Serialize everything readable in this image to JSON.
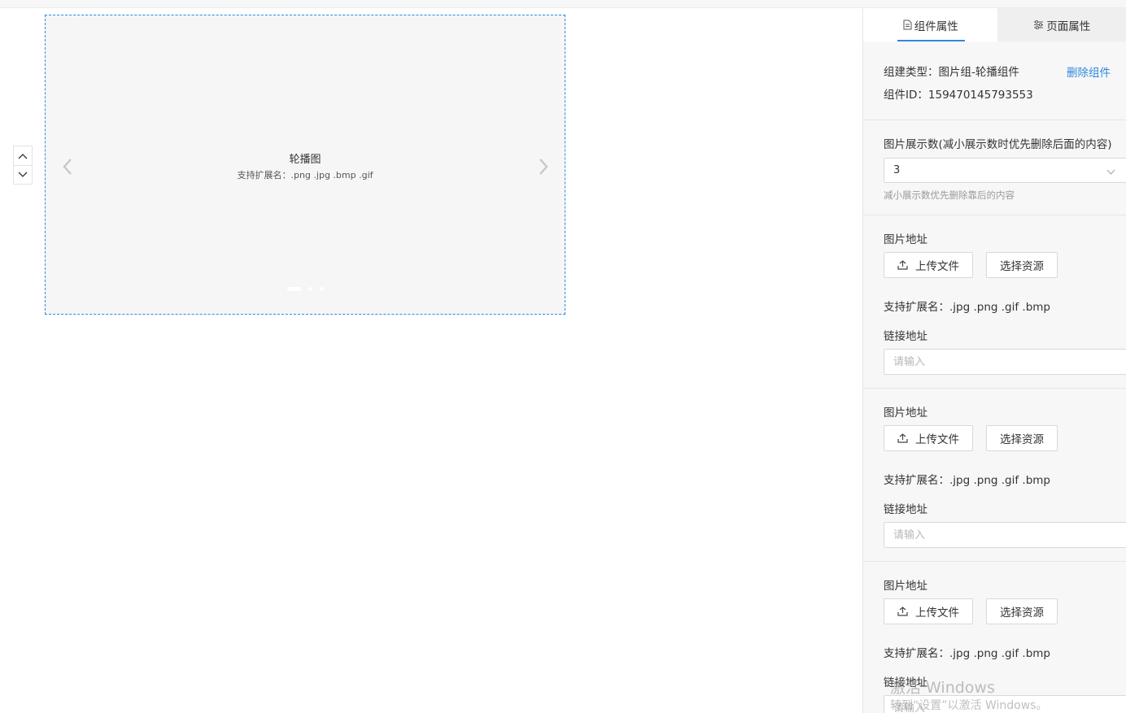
{
  "canvas": {
    "carousel": {
      "title": "轮播图",
      "subtitle": "支持扩展名：.png .jpg .bmp .gif",
      "dot_count": 3,
      "active_dot": 1
    }
  },
  "panel": {
    "tabs": [
      {
        "label": "组件属性",
        "icon": "document-icon",
        "active": true
      },
      {
        "label": "页面属性",
        "icon": "sliders-icon",
        "active": false
      }
    ],
    "component": {
      "type_label": "组建类型：",
      "type_value": "图片组-轮播组件",
      "delete_label": "删除组件",
      "id_label": "组件ID：",
      "id_value": "159470145793553"
    },
    "display_count": {
      "label": "图片展示数(减小展示数时优先删除后面的内容)",
      "value": "3",
      "hint": "减小展示数优先删除靠后的内容"
    },
    "images": [
      {
        "address_label": "图片地址",
        "upload_label": "上传文件",
        "resource_label": "选择资源",
        "ext_label": "支持扩展名：.jpg .png .gif .bmp",
        "link_label": "链接地址",
        "link_placeholder": "请输入",
        "link_value": ""
      },
      {
        "address_label": "图片地址",
        "upload_label": "上传文件",
        "resource_label": "选择资源",
        "ext_label": "支持扩展名：.jpg .png .gif .bmp",
        "link_label": "链接地址",
        "link_placeholder": "请输入",
        "link_value": ""
      },
      {
        "address_label": "图片地址",
        "upload_label": "上传文件",
        "resource_label": "选择资源",
        "ext_label": "支持扩展名：.jpg .png .gif .bmp",
        "link_label": "链接地址",
        "link_placeholder": "请输入",
        "link_value": ""
      }
    ]
  },
  "watermark": {
    "line1": "激活 Windows",
    "line2": "转到“设置”以激活 Windows。"
  },
  "colors": {
    "accent": "#2f88e0",
    "panel_bg": "#f7f7f7",
    "carousel_bg": "#f6f6f6"
  }
}
